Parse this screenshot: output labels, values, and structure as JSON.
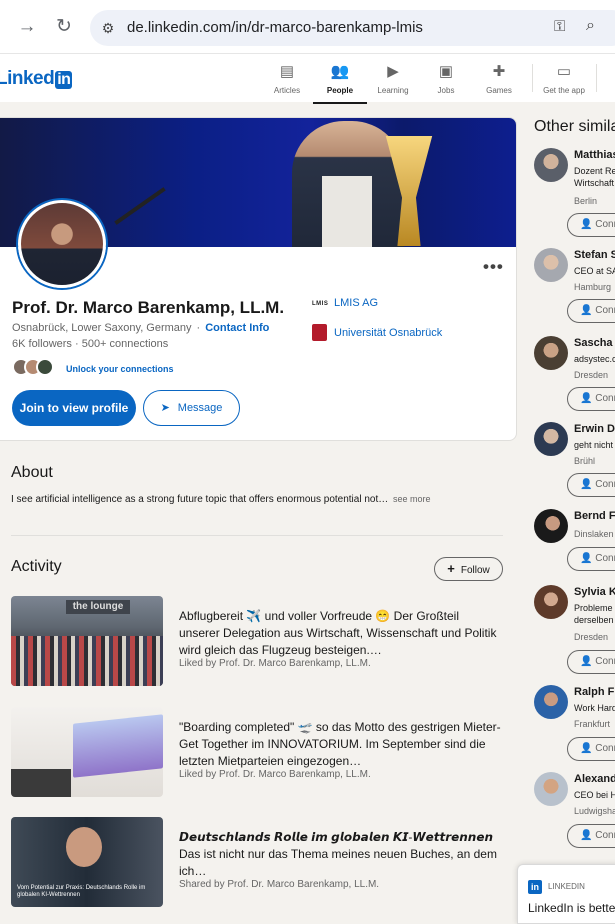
{
  "browser": {
    "url": "de.linkedin.com/in/dr-marco-barenkamp-lmis",
    "back_icon": "arrow-right-icon",
    "reload_icon": "reload-icon"
  },
  "header": {
    "logo_text": "Linked",
    "logo_in": "in",
    "nav": [
      {
        "label": "Articles",
        "icon": "articles-icon"
      },
      {
        "label": "People",
        "icon": "people-icon"
      },
      {
        "label": "Learning",
        "icon": "learning-icon"
      },
      {
        "label": "Jobs",
        "icon": "jobs-icon"
      },
      {
        "label": "Games",
        "icon": "games-icon"
      },
      {
        "label": "Get the app",
        "icon": "laptop-icon"
      }
    ]
  },
  "profile": {
    "name": "Prof. Dr. Marco Barenkamp, LL.M.",
    "location": "Osnabrück, Lower Saxony, Germany",
    "contact_info": "Contact Info",
    "followers": "6K followers",
    "connections": "500+ connections",
    "unlock": "Unlock your connections",
    "join_button": "Join to view profile",
    "message_button": "Message",
    "company_logo": "LMIS",
    "company": "LMIS AG",
    "university": "Universität Osnabrück"
  },
  "about": {
    "heading": "About",
    "text": "I see artificial intelligence as a strong future topic that offers enormous potential not…",
    "see_more": "see more"
  },
  "activity": {
    "heading": "Activity",
    "follow": "Follow",
    "posts": [
      {
        "text": "Abflugbereit ✈️ und voller Vorfreude 😁 Der Großteil unserer Delegation aus Wirtschaft, Wissenschaft und Politik wird gleich das Flugzeug besteigen.…",
        "by": "Liked by Prof. Dr. Marco Barenkamp, LL.M.",
        "thumb_sign": "the lounge"
      },
      {
        "text": "\"Boarding completed\" 🛫 so das Motto des gestrigen Mieter-Get Together im INNOVATORIUM. Im September sind die letzten Mietparteien eingezogen…",
        "by": "Liked by Prof. Dr. Marco Barenkamp, LL.M."
      },
      {
        "title": "𝘿𝙚𝙪𝙩𝙨𝙘𝙝𝙡𝙖𝙣𝙙𝙨 𝙍𝙤𝙡𝙡𝙚 𝙞𝙢 𝙜𝙡𝙤𝙗𝙖𝙡𝙚𝙣 𝙆𝙄-𝙒𝙚𝙩𝙩𝙧𝙚𝙣𝙣𝙚𝙣",
        "text": "Das ist nicht nur das Thema meines neuen Buches, an dem ich…",
        "by": "Shared by Prof. Dr. Marco Barenkamp, LL.M.",
        "thumb_caption": "Vom Potential zur Praxis: Deutschlands Rolle im globalen KI-Wettrennen"
      }
    ]
  },
  "sidebar": {
    "heading": "Other simila",
    "people": [
      {
        "name": "Matthias",
        "headline": [
          "Dozent Re",
          "Wirtschaft"
        ],
        "location": "Berlin",
        "connect": "Conn"
      },
      {
        "name": "Stefan Se",
        "headline": [
          "CEO at SA"
        ],
        "location": "Hamburg",
        "connect": "Conn"
      },
      {
        "name": "Sascha W",
        "headline": [
          "adsystec.c"
        ],
        "location": "Dresden",
        "connect": "Conn"
      },
      {
        "name": "Erwin Di",
        "headline": [
          "geht nicht"
        ],
        "location": "Brühl",
        "connect": "Conn"
      },
      {
        "name": "Bernd Fu",
        "headline": [],
        "location": "Dinslaken",
        "connect": "Conn"
      },
      {
        "name": "Sylvia Kr",
        "headline": [
          "Probleme",
          "derselben"
        ],
        "location": "Dresden",
        "connect": "Conn"
      },
      {
        "name": "Ralph Fu",
        "headline": [
          "Work Hard"
        ],
        "location": "Frankfurt",
        "connect": "Conn"
      },
      {
        "name": "Alexande",
        "headline": [
          "CEO bei H"
        ],
        "location": "Ludwigsha",
        "connect": "Conn"
      }
    ]
  },
  "popup": {
    "badge": "in",
    "label": "LINKEDIN",
    "message": "LinkedIn is better"
  }
}
